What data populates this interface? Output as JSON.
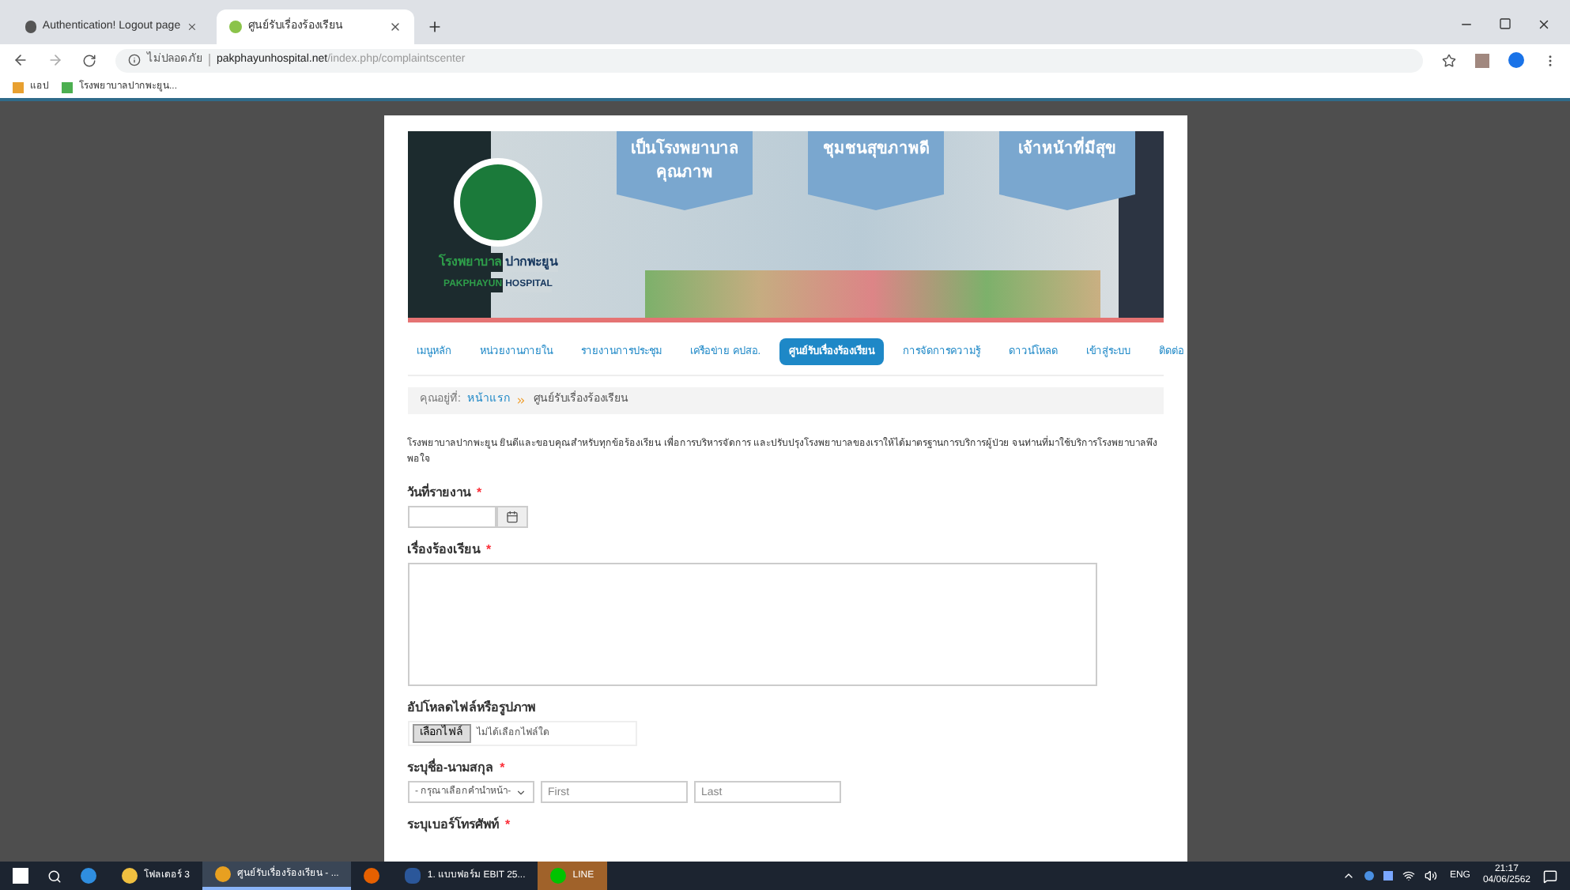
{
  "browser": {
    "tabs": [
      {
        "title": "Authentication! Logout page",
        "selected": false
      },
      {
        "title": "ศูนย์รับเรื่องร้องเรียน",
        "selected": true
      }
    ],
    "security": "ไม่ปลอดภัย",
    "url_host": "pakphayunhospital.net",
    "url_path": "/index.php/complaintscenter",
    "bookmarks": [
      "แอป",
      "โรงพยาบาลปากพะยูน..."
    ]
  },
  "banner": {
    "hospital_th_1": "โรงพยาบาล",
    "hospital_th_2": "ปากพะยูน",
    "hospital_en_1": "PAKPHAYUN",
    "hospital_en_2": "HOSPITAL",
    "slogans": [
      "เป็นโรงพยาบาล คุณภาพ",
      "ชุมชนสุขภาพดี",
      "เจ้าหน้าที่มีสุข"
    ]
  },
  "nav": [
    {
      "label": "เมนูหลัก",
      "selected": false
    },
    {
      "label": "หน่วยงานภายใน",
      "selected": false
    },
    {
      "label": "รายงานการประชุม",
      "selected": false
    },
    {
      "label": "เครือข่าย คปสอ.",
      "selected": false
    },
    {
      "label": "ศูนย์รับเรื่องร้องเรียน",
      "selected": true
    },
    {
      "label": "การจัดการความรู้",
      "selected": false
    },
    {
      "label": "ดาวน์โหลด",
      "selected": false
    },
    {
      "label": "เข้าสู่ระบบ",
      "selected": false
    },
    {
      "label": "ติดต่อ",
      "selected": false
    }
  ],
  "breadcrumb": {
    "prefix": "คุณอยู่ที่:",
    "items": [
      "หน้าแรก",
      "ศูนย์รับเรื่องร้องเรียน"
    ]
  },
  "intro": "โรงพยาบาลปากพะยูน ยินดีและขอบคุณสำหรับทุกข้อร้องเรียน เพื่อการบริหารจัดการ และปรับปรุงโรงพยาบาลของเราให้ได้มาตรฐานการบริการผู้ป่วย จนท่านที่มาใช้บริการโรงพยาบาลพึงพอใจ",
  "form": [
    {
      "kind": "date",
      "label": "วันที่รายงาน",
      "required_mark": "*"
    },
    {
      "kind": "textarea",
      "label": "เรื่องร้องเรียน",
      "required_mark": "*"
    },
    {
      "kind": "file",
      "label": "อัปโหลดไฟล์หรือรูปภาพ",
      "button": "เลือกไฟล์",
      "status": "ไม่ได้เลือกไฟล์ใด"
    },
    {
      "kind": "name",
      "label": "ระบุชื่อ-นามสกุล",
      "required_mark": "*",
      "select": "- กรุณาเลือกคำนำหน้า-",
      "inputs": [
        {
          "placeholder": "First"
        },
        {
          "placeholder": "Last"
        }
      ]
    },
    {
      "kind": "heading",
      "label": "ระบุเบอร์โทรศัพท์",
      "required_mark": "*"
    }
  ],
  "taskbar": {
    "items": [
      {
        "kind": "folder",
        "label": "โฟลเดอร์ 3",
        "selected": false
      },
      {
        "kind": "chrome",
        "label": "ศูนย์รับเรื่องร้องเรียน - ...",
        "selected": true
      },
      {
        "kind": "firefox",
        "selected": false
      },
      {
        "kind": "word",
        "label": "1. แบบฟอร์ม EBIT 25...",
        "selected": false
      },
      {
        "kind": "line",
        "label": "LINE",
        "selected": false
      }
    ],
    "lang": "ENG",
    "time": "21:17",
    "date": "04/06/2562"
  }
}
